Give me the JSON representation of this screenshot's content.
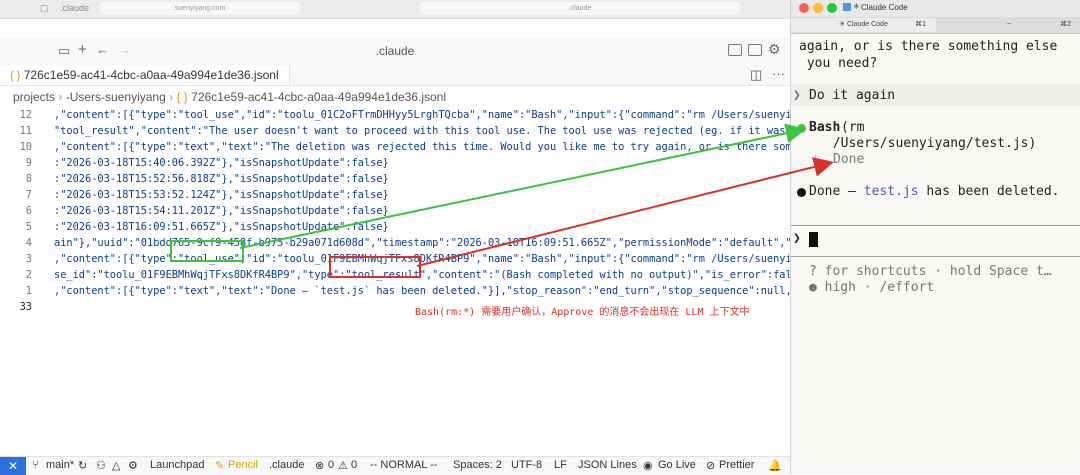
{
  "browser": {
    "tab_title": ".claude",
    "url_left": "suenyiyang.com",
    "url_right": ".claude"
  },
  "vscode": {
    "window_title": ".claude",
    "tab": {
      "label": "726c1e59-ac41-4cbc-a0aa-49a994e1de36.jsonl"
    },
    "breadcrumb": [
      "projects",
      "-Users-suenyiyang",
      "726c1e59-ac41-4cbc-a0aa-49a994e1de36.jsonl"
    ],
    "lines": [
      {
        "n": "12",
        "text": ",\"content\":[{\"type\":\"tool_use\",\"id\":\"toolu_01C2oFTrmDHHyy5LrghTQcba\",\"name\":\"Bash\",\"input\":{\"command\":\"rm /Users/suenyiyang"
      },
      {
        "n": "11",
        "text": "\"tool_result\",\"content\":\"The user doesn't want to proceed with this tool use. The tool use was rejected (eg. if it was a f"
      },
      {
        "n": "10",
        "text": ",\"content\":[{\"type\":\"text\",\"text\":\"The deletion was rejected this time. Would you like me to try again, or is there somethi"
      },
      {
        "n": "9",
        "text": ":\"2026-03-18T15:40:06.392Z\"},\"isSnapshotUpdate\":false}"
      },
      {
        "n": "8",
        "text": ":\"2026-03-18T15:52:56.818Z\"},\"isSnapshotUpdate\":false}"
      },
      {
        "n": "7",
        "text": ":\"2026-03-18T15:53:52.124Z\"},\"isSnapshotUpdate\":false}"
      },
      {
        "n": "6",
        "text": ":\"2026-03-18T15:54:11.201Z\"},\"isSnapshotUpdate\":false}"
      },
      {
        "n": "5",
        "text": ":\"2026-03-18T16:09:51.665Z\"},\"isSnapshotUpdate\":false}"
      },
      {
        "n": "4",
        "text": "ain\"},\"uuid\":\"01bdd765-9cf9-458f-b975-b29a071d608d\",\"timestamp\":\"2026-03-18T16:09:51.665Z\",\"permissionMode\":\"default\",\"use"
      },
      {
        "n": "3",
        "text": ",\"content\":[{\"type\":\"tool_use\",\"id\":\"toolu_01F9EBMhWqjTFxs8DKfR4BP9\",\"name\":\"Bash\",\"input\":{\"command\":\"rm /Users/suenyiyan"
      },
      {
        "n": "2",
        "text": "se_id\":\"toolu_01F9EBMhWqjTFxs8DKfR4BP9\",\"type\":\"tool_result\",\"content\":\"(Bash completed with no output)\",\"is_error\":false}"
      },
      {
        "n": "1",
        "text": ",\"content\":[{\"type\":\"text\",\"text\":\"Done — `test.js` has been deleted.\"}],\"stop_reason\":\"end_turn\",\"stop_sequence\":null,\"us"
      },
      {
        "n": "33",
        "text": ""
      }
    ],
    "annotation": "Bash(rm:*) 需要用户确认，Approve 的消息不会出现在 LLM 上下文中",
    "statusbar": {
      "branch": "main*",
      "launchpad": "Launchpad",
      "pencil": "Pencil",
      "folder": ".claude",
      "errors": "0",
      "warnings": "0",
      "mode": "-- NORMAL --",
      "spaces": "Spaces: 2",
      "encoding": "UTF-8",
      "eol": "LF",
      "language": "JSON Lines",
      "golive": "Go Live",
      "prettier": "Prettier"
    }
  },
  "terminal": {
    "window_title": "Claude Code",
    "tab1": "Claude Code",
    "tab1_shortcut": "⌘1",
    "tab2": "~",
    "tab2_shortcut": "⌘2",
    "line1": "again, or is there something else",
    "line2": " you need?",
    "user_prompt_symbol": "❯",
    "user_prompt": "Do it again",
    "tool_call": "Bash",
    "tool_arg1": "(rm",
    "tool_arg2": " /Users/suenyiyang/test.js)",
    "tool_result": "Done",
    "done_prefix": "Done — ",
    "done_file": "test.js",
    "done_suffix": " has been deleted.",
    "input_symbol": "❯",
    "footer1": "? for shortcuts · hold Space t…",
    "footer2": "● high · /effort"
  },
  "colors": {
    "green_arrow": "#3cc43c",
    "red_arrow": "#d6332a",
    "status_blue": "#2f6fdb",
    "pencil_yellow": "#d4a017"
  }
}
